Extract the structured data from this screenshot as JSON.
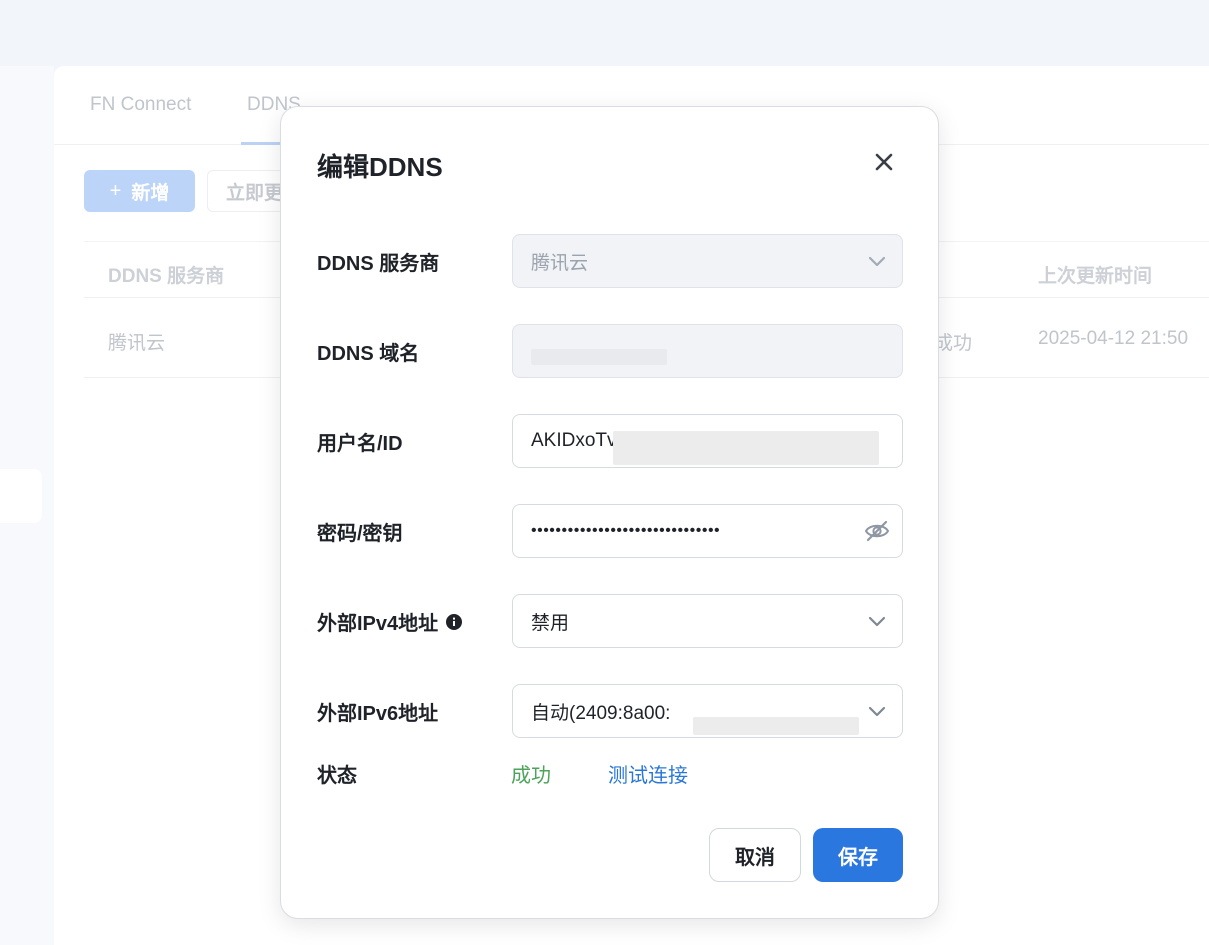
{
  "background": {
    "tabs": [
      {
        "label": "FN Connect"
      },
      {
        "label": "DDNS"
      }
    ],
    "toolbar": {
      "add_label": "新增",
      "update_label": "立即更新"
    },
    "table": {
      "headers": {
        "provider": "DDNS 服务商",
        "last_update": "上次更新时间"
      },
      "rows": [
        {
          "provider": "腾讯云",
          "status": "成功",
          "last_update": "2025-04-12 21:50"
        }
      ]
    }
  },
  "modal": {
    "title": "编辑DDNS",
    "fields": {
      "provider": {
        "label": "DDNS 服务商",
        "value": "腾讯云"
      },
      "domain": {
        "label": "DDNS 域名",
        "value": ""
      },
      "username": {
        "label": "用户名/ID",
        "value": "AKIDxoTv"
      },
      "password": {
        "label": "密码/密钥",
        "value": "•••••••••••••••••••••••••••••••"
      },
      "ipv4": {
        "label": "外部IPv4地址",
        "value": "禁用"
      },
      "ipv6": {
        "label": "外部IPv6地址",
        "value": "自动(2409:8a00:"
      }
    },
    "status": {
      "label": "状态",
      "value": "成功",
      "test_link": "测试连接"
    },
    "buttons": {
      "cancel": "取消",
      "save": "保存"
    }
  },
  "colors": {
    "accent": "#2a77e0",
    "success": "#4ca35a",
    "link": "#2a77d6"
  }
}
